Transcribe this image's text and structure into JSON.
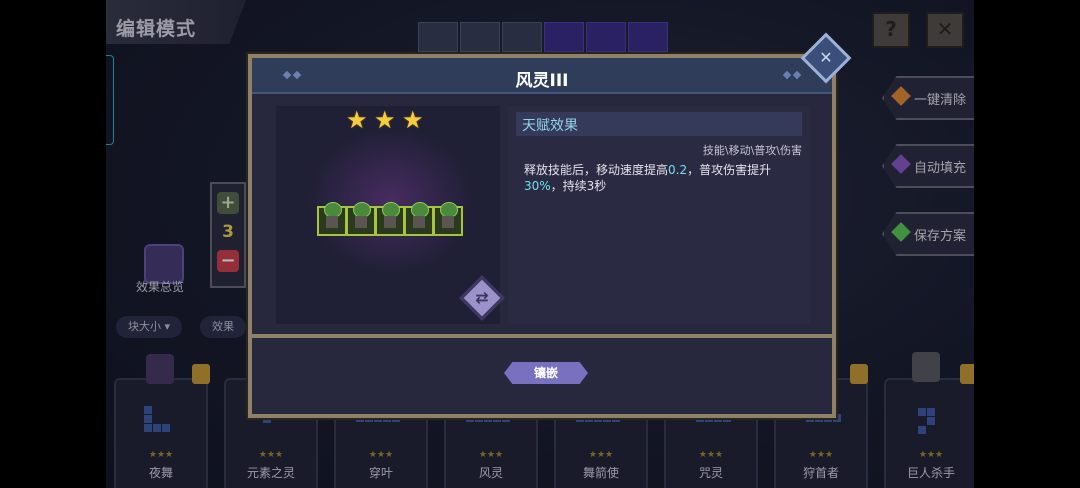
{
  "header": {
    "mode_title": "编辑模式",
    "help_icon": "question-icon",
    "close_icon": "close-icon"
  },
  "left": {
    "counter_value": "3",
    "effect_overview_label": "效果总览",
    "filter_size": "块大小",
    "filter_effect": "效果"
  },
  "side_buttons": [
    {
      "label": "一键清除",
      "color": "#e08a3a"
    },
    {
      "label": "自动填充",
      "color": "#8a5ac8"
    },
    {
      "label": "保存方案",
      "color": "#5ac85a"
    }
  ],
  "cards": [
    {
      "name": "夜舞",
      "stars": "★★★"
    },
    {
      "name": "元素之灵",
      "stars": "★★★"
    },
    {
      "name": "穿叶",
      "stars": "★★★"
    },
    {
      "name": "风灵",
      "stars": "★★★"
    },
    {
      "name": "舞箭使",
      "stars": "★★★"
    },
    {
      "name": "咒灵",
      "stars": "★★★"
    },
    {
      "name": "狩首者",
      "stars": "★★★"
    },
    {
      "name": "巨人杀手",
      "stars": "★★★"
    }
  ],
  "dialog": {
    "title": "风灵III",
    "star_count": 3,
    "stone_count": 5,
    "talent_header": "天赋效果",
    "tags": "技能\\移动\\普攻\\伤害",
    "desc_part1": "释放技能后，移动速度提高",
    "desc_val1": "0.2",
    "desc_part2": "，普攻伤害提升",
    "desc_val2": "30%",
    "desc_part3": "，持续3秒",
    "inlay_button": "镶嵌",
    "swap_icon": "swap-icon"
  }
}
